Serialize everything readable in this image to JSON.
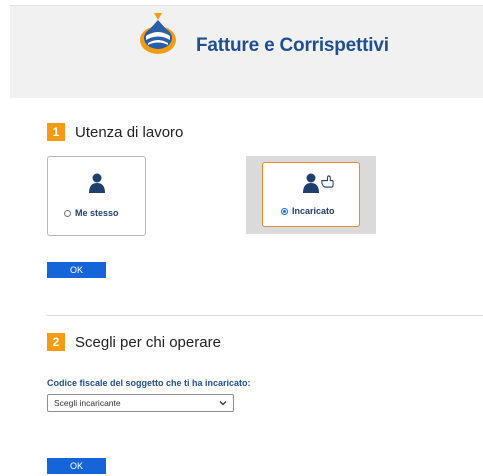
{
  "header": {
    "title": "Fatture e Corrispettivi",
    "logo": "agenzia-entrate-logo-icon",
    "colors": {
      "title": "#1f4f8f",
      "logo_orange": "#f39c12",
      "logo_blue": "#2b5ea8"
    }
  },
  "step1": {
    "number": "1",
    "title": "Utenza di lavoro",
    "options": [
      {
        "label": "Me stesso",
        "selected": false,
        "icon": "person-icon"
      },
      {
        "label": "Incaricato",
        "selected": true,
        "icon": "person-pointer-icon"
      }
    ],
    "ok_label": "OK"
  },
  "step2": {
    "number": "2",
    "title": "Scegli per chi operare",
    "field_label": "Codice fiscale del soggetto che ti ha incaricato:",
    "select_value": "Scegli incaricante",
    "ok_label": "OK"
  },
  "colors": {
    "step_badge": "#f39c12",
    "button": "#1565d8",
    "selected_border": "#e98a2d"
  }
}
